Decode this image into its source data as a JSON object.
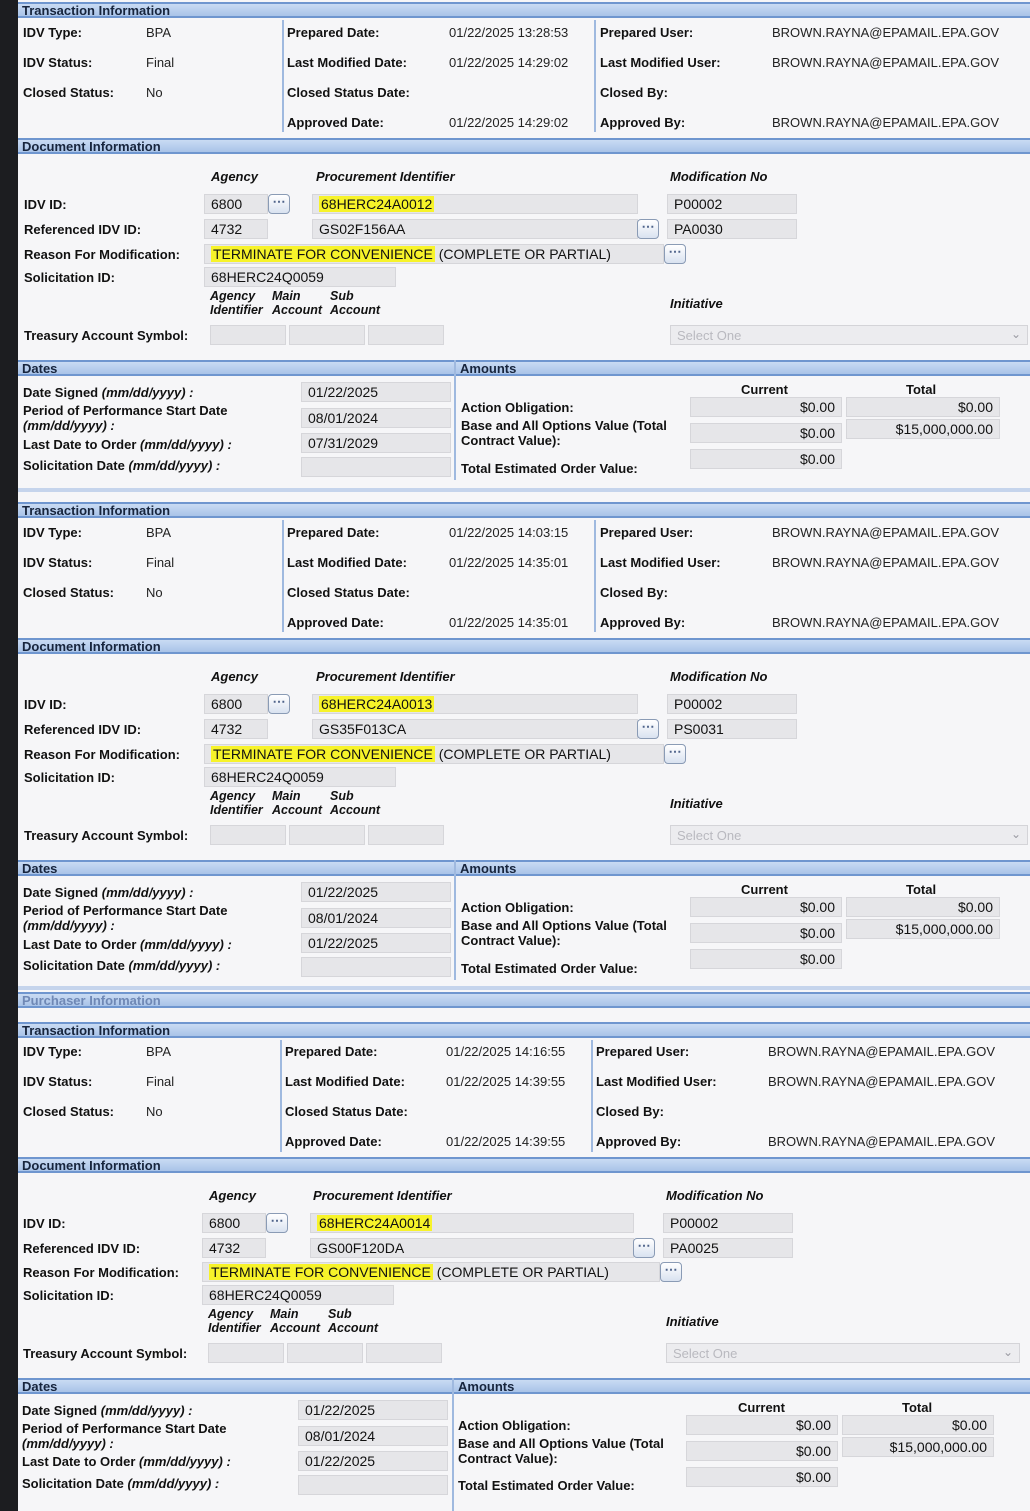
{
  "labels": {
    "transaction_info": "Transaction Information",
    "document_info": "Document Information",
    "dates": "Dates",
    "amounts": "Amounts",
    "purchaser_info": "Purchaser Information",
    "idv_type": "IDV Type:",
    "idv_status": "IDV Status:",
    "closed_status": "Closed Status:",
    "prepared_date": "Prepared Date:",
    "last_modified_date": "Last Modified Date:",
    "closed_status_date": "Closed Status Date:",
    "approved_date": "Approved Date:",
    "prepared_user": "Prepared User:",
    "last_modified_user": "Last Modified User:",
    "closed_by": "Closed By:",
    "approved_by": "Approved By:",
    "agency": "Agency",
    "procurement_identifier": "Procurement Identifier",
    "modification_no": "Modification No",
    "idv_id": "IDV ID:",
    "referenced_idv_id": "Referenced IDV ID:",
    "reason_for_modification": "Reason For Modification:",
    "solicitation_id": "Solicitation ID:",
    "tas_agency_identifier": "Agency Identifier",
    "tas_main_account": "Main Account",
    "tas_sub_account": "Sub Account",
    "tas_agency_identifier_1": "Agency",
    "tas_agency_identifier_2": "Identifier",
    "tas_main_account_1": "Main",
    "tas_main_account_2": "Account",
    "tas_sub_account_1": "Sub",
    "tas_sub_account_2": "Account",
    "initiative": "Initiative",
    "treasury_account_symbol": "Treasury Account Symbol:",
    "select_one": "Select One",
    "date_signed": "Date Signed",
    "date_fmt": "(mm/dd/yyyy) :",
    "period_of_performance_start": "Period of Performance Start Date",
    "date_fmt_2": "(mm/dd/yyyy) :",
    "last_date_to_order": "Last Date to Order",
    "solicitation_date": "Solicitation Date",
    "current": "Current",
    "total": "Total",
    "action_obligation": "Action Obligation:",
    "base_and_all_options_1": "Base and All Options Value (Total",
    "base_and_all_options_2": "Contract Value):",
    "total_estimated_order_value": "Total Estimated Order Value:",
    "ellipsis": "⋯"
  },
  "records": [
    {
      "idv_type": "BPA",
      "idv_status": "Final",
      "closed_status": "No",
      "prepared_date": "01/22/2025 13:28:53",
      "last_modified_date": "01/22/2025 14:29:02",
      "closed_status_date": "",
      "approved_date": "01/22/2025 14:29:02",
      "prepared_user": "BROWN.RAYNA@EPAMAIL.EPA.GOV",
      "last_modified_user": "BROWN.RAYNA@EPAMAIL.EPA.GOV",
      "closed_by": "",
      "approved_by": "BROWN.RAYNA@EPAMAIL.EPA.GOV",
      "idv_agency": "6800",
      "idv_procurement_id": "68HERC24A0012",
      "idv_mod_no": "P00002",
      "ref_agency": "4732",
      "ref_procurement_id": "GS02F156AA",
      "ref_mod_no": "PA0030",
      "reason_highlight": "TERMINATE FOR CONVENIENCE",
      "reason_rest": "(COMPLETE OR PARTIAL)",
      "solicitation_id": "68HERC24Q0059",
      "date_signed": "01/22/2025",
      "pop_start": "08/01/2024",
      "last_date_to_order": "07/31/2029",
      "solicitation_date": "",
      "action_obligation_current": "$0.00",
      "action_obligation_total": "$0.00",
      "base_all_options_current": "$0.00",
      "base_all_options_total": "$15,000,000.00",
      "total_est_order_current": "$0.00"
    },
    {
      "idv_type": "BPA",
      "idv_status": "Final",
      "closed_status": "No",
      "prepared_date": "01/22/2025 14:03:15",
      "last_modified_date": "01/22/2025 14:35:01",
      "closed_status_date": "",
      "approved_date": "01/22/2025 14:35:01",
      "prepared_user": "BROWN.RAYNA@EPAMAIL.EPA.GOV",
      "last_modified_user": "BROWN.RAYNA@EPAMAIL.EPA.GOV",
      "closed_by": "",
      "approved_by": "BROWN.RAYNA@EPAMAIL.EPA.GOV",
      "idv_agency": "6800",
      "idv_procurement_id": "68HERC24A0013",
      "idv_mod_no": "P00002",
      "ref_agency": "4732",
      "ref_procurement_id": "GS35F013CA",
      "ref_mod_no": "PS0031",
      "reason_highlight": "TERMINATE FOR CONVENIENCE",
      "reason_rest": "(COMPLETE OR PARTIAL)",
      "solicitation_id": "68HERC24Q0059",
      "date_signed": "01/22/2025",
      "pop_start": "08/01/2024",
      "last_date_to_order": "01/22/2025",
      "solicitation_date": "",
      "action_obligation_current": "$0.00",
      "action_obligation_total": "$0.00",
      "base_all_options_current": "$0.00",
      "base_all_options_total": "$15,000,000.00",
      "total_est_order_current": "$0.00"
    },
    {
      "idv_type": "BPA",
      "idv_status": "Final",
      "closed_status": "No",
      "prepared_date": "01/22/2025 14:16:55",
      "last_modified_date": "01/22/2025 14:39:55",
      "closed_status_date": "",
      "approved_date": "01/22/2025 14:39:55",
      "prepared_user": "BROWN.RAYNA@EPAMAIL.EPA.GOV",
      "last_modified_user": "BROWN.RAYNA@EPAMAIL.EPA.GOV",
      "closed_by": "",
      "approved_by": "BROWN.RAYNA@EPAMAIL.EPA.GOV",
      "idv_agency": "6800",
      "idv_procurement_id": "68HERC24A0014",
      "idv_mod_no": "P00002",
      "ref_agency": "4732",
      "ref_procurement_id": "GS00F120DA",
      "ref_mod_no": "PA0025",
      "reason_highlight": "TERMINATE FOR CONVENIENCE",
      "reason_rest": "(COMPLETE OR PARTIAL)",
      "solicitation_id": "68HERC24Q0059",
      "date_signed": "01/22/2025",
      "pop_start": "08/01/2024",
      "last_date_to_order": "01/22/2025",
      "solicitation_date": "",
      "action_obligation_current": "$0.00",
      "action_obligation_total": "$0.00",
      "base_all_options_current": "$0.00",
      "base_all_options_total": "$15,000,000.00",
      "total_est_order_current": "$0.00"
    }
  ],
  "colors": {
    "highlight": "#f7f32a",
    "section_bar": "#a9c3e8",
    "section_border": "#6f96cf"
  }
}
